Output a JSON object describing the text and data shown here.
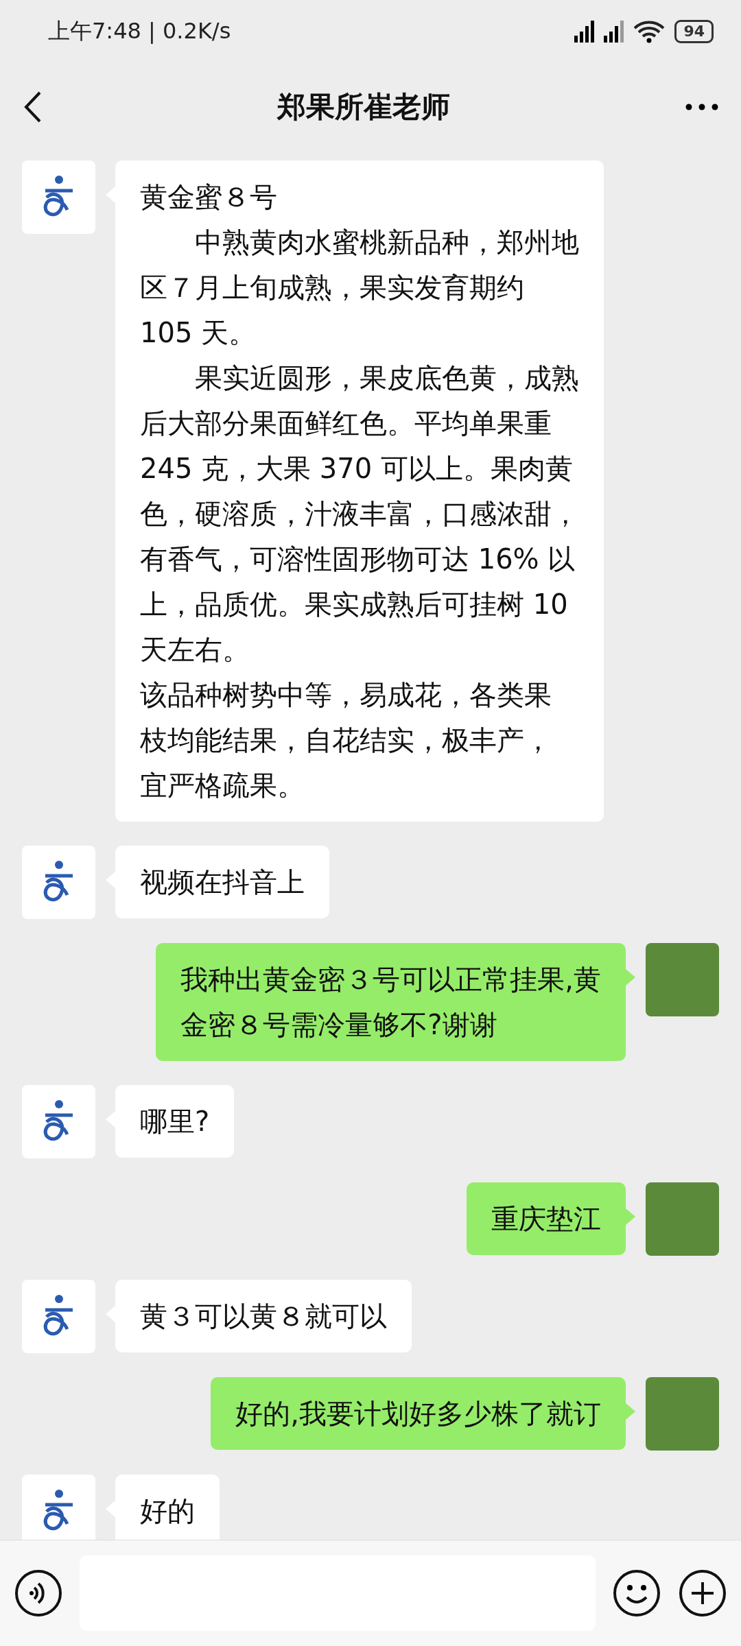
{
  "status_bar": {
    "time": "上午7:48 | 0.2K/s",
    "battery": "94"
  },
  "header": {
    "title": "郑果所崔老师"
  },
  "messages": [
    {
      "outgoing": false,
      "lines": [
        "黄金蜜８号",
        "　　中熟黄肉水蜜桃新品种，郑州地",
        "区７月上旬成熟，果实发育期约",
        "105 天。",
        "　　果实近圆形，果皮底色黄，成熟",
        "后大部分果面鲜红色。平均单果重",
        "245 克，大果 370 可以上。果肉黄",
        "色，硬溶质，汁液丰富，口感浓甜，",
        "有香气，可溶性固形物可达 16% 以",
        "上，品质优。果实成熟后可挂树 10",
        "天左右。",
        "该品种树势中等，易成花，各类果",
        "枝均能结果，自花结实，极丰产，",
        "宜严格疏果。"
      ]
    },
    {
      "outgoing": false,
      "lines": [
        "视频在抖音上"
      ]
    },
    {
      "outgoing": true,
      "lines": [
        "我种出黄金密３号可以正常挂果,黄",
        "金密８号需冷量够不?谢谢"
      ]
    },
    {
      "outgoing": false,
      "lines": [
        "哪里?"
      ]
    },
    {
      "outgoing": true,
      "lines": [
        "重庆垫江"
      ]
    },
    {
      "outgoing": false,
      "lines": [
        "黄３可以黄８就可以"
      ]
    },
    {
      "outgoing": true,
      "lines": [
        "好的,我要计划好多少株了就订"
      ]
    },
    {
      "outgoing": false,
      "lines": [
        "好的"
      ]
    }
  ]
}
